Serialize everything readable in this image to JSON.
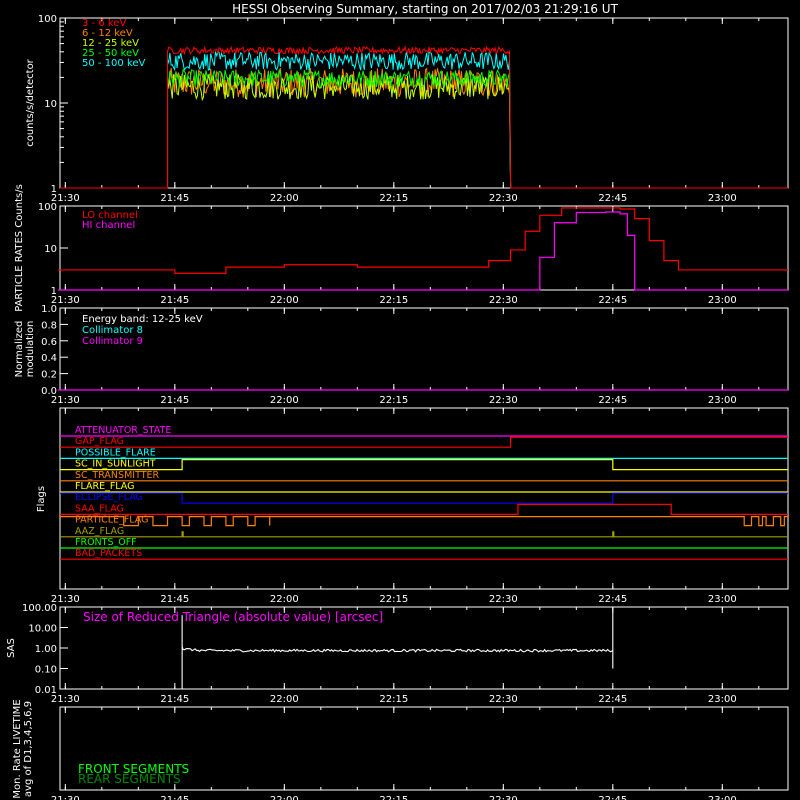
{
  "title": "HESSI Observing Summary, starting on 2017/02/03 21:29:16 UT",
  "time_ticks": [
    "21:30",
    "21:45",
    "22:00",
    "22:15",
    "22:30",
    "22:45",
    "23:00"
  ],
  "colors": {
    "red": "#ff0000",
    "orange": "#ff8000",
    "green_yellow": "#c8ff00",
    "green": "#00ff00",
    "cyan": "#00ffff",
    "yellow": "#ffff00",
    "magenta": "#ff00ff",
    "crimson": "#ff2060",
    "blue": "#0000ff",
    "olive": "#a0a000",
    "white": "#ffffff"
  },
  "chart_data": [
    {
      "type": "line",
      "ylabel": "counts/s/detector",
      "yticks": [
        "1",
        "10",
        "100"
      ],
      "ylim": [
        1,
        100
      ],
      "yscale": "log",
      "legend": [
        "3 - 6 keV",
        "6 - 12 keV",
        "12 - 25 keV",
        "25 - 50 keV",
        "50 - 100 keV"
      ],
      "data_window": [
        "21:44",
        "22:31"
      ],
      "series": [
        {
          "name": "3 - 6 keV",
          "level": 42
        },
        {
          "name": "6 - 12 keV",
          "level": 18
        },
        {
          "name": "12 - 25 keV",
          "level": 16
        },
        {
          "name": "25 - 50 keV",
          "level": 20
        },
        {
          "name": "50 - 100 keV",
          "level": 32
        }
      ]
    },
    {
      "type": "line",
      "ylabel": "PARTICLE RATES Counts/s",
      "yticks": [
        "1",
        "10",
        "100"
      ],
      "ylim": [
        1,
        100
      ],
      "yscale": "log",
      "legend": [
        "LO channel",
        "HI channel"
      ],
      "series": [
        {
          "name": "LO channel",
          "x": [
            "21:29",
            "21:42",
            "21:45",
            "21:52",
            "22:00",
            "22:10",
            "22:20",
            "22:28",
            "22:31",
            "22:33",
            "22:35",
            "22:38",
            "22:42",
            "22:46",
            "22:48",
            "22:50",
            "22:52",
            "22:54",
            "23:00",
            "23:09"
          ],
          "y": [
            3,
            3,
            2.5,
            3.5,
            4,
            3.5,
            3.5,
            5,
            9,
            25,
            60,
            90,
            90,
            85,
            50,
            15,
            5,
            3,
            3,
            3
          ]
        },
        {
          "name": "HI channel",
          "x": [
            "21:29",
            "22:34",
            "22:35",
            "22:37",
            "22:40",
            "22:44",
            "22:46",
            "22:47",
            "22:48",
            "23:09"
          ],
          "y": [
            1,
            1,
            6,
            40,
            70,
            72,
            65,
            20,
            1,
            1
          ]
        }
      ]
    },
    {
      "type": "line",
      "ylabel": "Normalized modulation",
      "yticks": [
        "0.0",
        "0.2",
        "0.4",
        "0.6",
        "0.8",
        "1.0"
      ],
      "ylim": [
        0,
        1
      ],
      "legend": [
        "Energy band: 12-25 keV",
        "Collimator 8",
        "Collimator 9"
      ],
      "series": [
        {
          "name": "Collimator 9",
          "x": [
            "21:29",
            "23:09"
          ],
          "y": [
            0,
            0
          ]
        }
      ]
    },
    {
      "type": "line",
      "ylabel": "Flags",
      "flags": [
        {
          "name": "ATTENUATOR_STATE",
          "color": "#ff00ff",
          "x": [],
          "on": 0
        },
        {
          "name": "GAP_FLAG",
          "color": "#ff0000",
          "x": [
            "22:31"
          ],
          "on": 0
        },
        {
          "name": "POSSIBLE_FLARE",
          "color": "#00ffff",
          "x": [],
          "on": 0
        },
        {
          "name": "SC_IN_SUNLIGHT",
          "color": "#ffff00",
          "x": [
            "21:46",
            "22:45"
          ],
          "on": 0
        },
        {
          "name": "SC_TRANSMITTER",
          "color": "#ff8000",
          "x": [],
          "on": 0
        },
        {
          "name": "FLARE_FLAG",
          "color": "#ffff00",
          "x": [],
          "on": 0
        },
        {
          "name": "ECLIPSE_FLAG",
          "color": "#0000ff",
          "x": [
            "21:46",
            "22:45"
          ],
          "on": 1
        },
        {
          "name": "SAA_FLAG",
          "color": "#ff0000",
          "x": [
            "22:32",
            "22:53"
          ],
          "on": 0
        },
        {
          "name": "PARTICLE_FLAG",
          "color": "#ff8000",
          "x": [],
          "on": 1
        },
        {
          "name": "AAZ_FLAG",
          "color": "#a0a000",
          "x": [],
          "on": 0
        },
        {
          "name": "FRONTS_OFF",
          "color": "#00ff00",
          "x": [],
          "on": 0
        },
        {
          "name": "BAD_PACKETS",
          "color": "#ff0000",
          "x": [],
          "on": 0
        }
      ]
    },
    {
      "type": "line",
      "ylabel": "SAS",
      "yticks": [
        "0.01",
        "0.10",
        "1.00",
        "10.00",
        "100.00"
      ],
      "ylim": [
        0.01,
        100
      ],
      "yscale": "log",
      "legend": [
        "Size of Reduced Triangle (absolute value) [arcsec]"
      ],
      "data_window": [
        "21:46",
        "22:45"
      ],
      "series": [
        {
          "name": "Size of Reduced Triangle (absolute value) [arcsec]",
          "level": 0.75
        }
      ]
    },
    {
      "type": "line",
      "ylabel": "Mon. Rate LIVETIME avg of D1,3,4,5,6,9",
      "legend": [
        "FRONT SEGMENTS",
        "REAR SEGMENTS"
      ],
      "series": []
    }
  ]
}
